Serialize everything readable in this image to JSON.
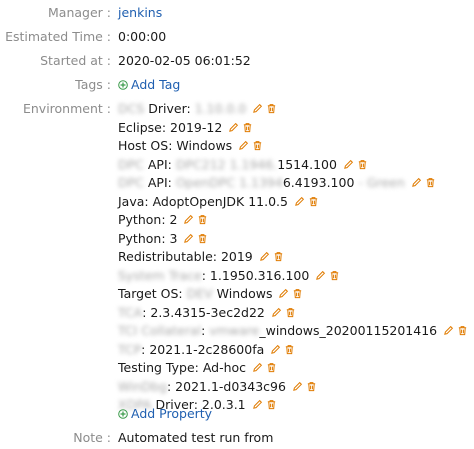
{
  "manager": {
    "label": "Manager :",
    "value": "jenkins"
  },
  "estimated_time": {
    "label": "Estimated Time :",
    "value": "0:00:00"
  },
  "started_at": {
    "label": "Started at :",
    "value": "2020-02-05 06:01:52"
  },
  "tags": {
    "label": "Tags :",
    "add_label": "Add Tag"
  },
  "environment": {
    "label": "Environment :",
    "items": [
      {
        "blurred": "DCS",
        "text": " Driver: ",
        "blurred2": "1.10.0.0"
      },
      {
        "blurred": "",
        "text": "Eclipse: 2019-12",
        "blurred2": ""
      },
      {
        "blurred": "",
        "text": "Host OS: Windows",
        "blurred2": ""
      },
      {
        "blurred": "DPC",
        "text": " API: ",
        "blurred2": "DPC212 1.1946.",
        "text2": "1514.100"
      },
      {
        "blurred": "DPC",
        "text": " API: ",
        "blurred2": "OpenDPC 1.1394",
        "text2": "6.4193.100",
        "blurred3": "- Green"
      },
      {
        "blurred": "",
        "text": "Java: AdoptOpenJDK 11.0.5",
        "blurred2": ""
      },
      {
        "blurred": "",
        "text": "Python: 2",
        "blurred2": ""
      },
      {
        "blurred": "",
        "text": "Python: 3",
        "blurred2": ""
      },
      {
        "blurred": "",
        "text": "Redistributable: 2019",
        "blurred2": ""
      },
      {
        "blurred": "System Trace",
        "text": ": 1.1950.316.100",
        "blurred2": ""
      },
      {
        "blurred": "",
        "text": "Target OS: ",
        "blurred2": "DEV",
        "text2": " Windows"
      },
      {
        "blurred": "TCA",
        "text": ": 2.3.4315-3ec2d22",
        "blurred2": ""
      },
      {
        "blurred": "TCI Collateral",
        "text": ": ",
        "blurred2": "vmware",
        "text2": "_windows_20200115201416"
      },
      {
        "blurred": "TCP",
        "text": ": 2021.1-2c28600fa",
        "blurred2": ""
      },
      {
        "blurred": "",
        "text": "Testing Type: Ad-hoc",
        "blurred2": ""
      },
      {
        "blurred": "WinDbg",
        "text": ": 2021.1-d0343c96",
        "blurred2": ""
      },
      {
        "blurred": "XDPA",
        "text": " Driver: 2.0.3.1",
        "blurred2": ""
      }
    ],
    "add_label": "Add Property"
  },
  "note": {
    "label": "Note :",
    "value": "Automated test run from"
  },
  "colors": {
    "link": "#1f5fb0",
    "icon": "#e07b00",
    "label": "#8c8c8c"
  },
  "icons": {
    "edit": "pencil-icon",
    "delete": "trash-icon",
    "add": "plus-icon"
  }
}
